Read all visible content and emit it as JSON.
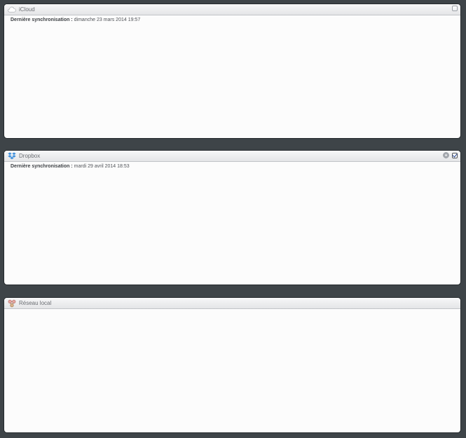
{
  "panels": {
    "icloud": {
      "title": "iCloud",
      "icon": "cloud-icon",
      "sync_label": "Dernière synchronisation :",
      "sync_value": "dimanche 23 mars 2014 19:57",
      "enabled": false
    },
    "dropbox": {
      "title": "Dropbox",
      "icon": "dropbox-icon",
      "sync_label": "Dernière synchronisation :",
      "sync_value": "mardi 29 avril 2014 18:53",
      "enabled": true
    },
    "local": {
      "title": "Réseau local",
      "icon": "local-network-icon"
    }
  },
  "colors": {
    "background": "#3e4448",
    "panel": "#fcfcfc",
    "header_top": "#f7f7f8",
    "header_bottom": "#e4e5e7",
    "dropbox_blue": "#3d8fdc",
    "checkmark": "#1f3f8f"
  }
}
